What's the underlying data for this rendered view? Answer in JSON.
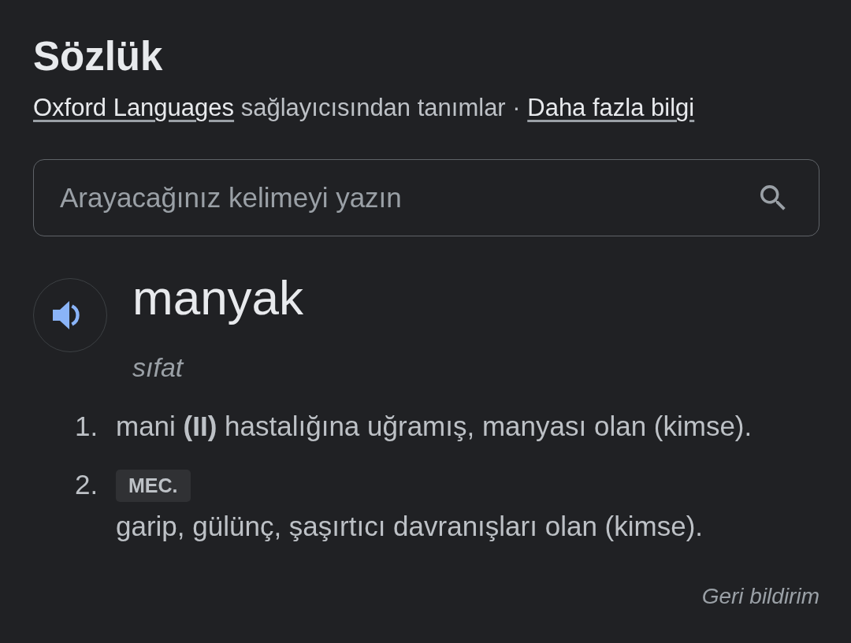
{
  "title": "Sözlük",
  "source": {
    "provider_link": "Oxford Languages",
    "text": "sağlayıcısından tanımlar ·",
    "more_link": "Daha fazla bilgi"
  },
  "search": {
    "placeholder": "Arayacağınız kelimeyi yazın"
  },
  "entry": {
    "word": "manyak",
    "part_of_speech": "sıfat",
    "senses": [
      {
        "number": "1.",
        "definition": "mani **(II)** hastalığına uğramış, manyası olan (kimse)."
      },
      {
        "number": "2.",
        "label": "MEC.",
        "definition": "garip, gülünç, şaşırtıcı davranışları olan (kimse)."
      }
    ]
  },
  "feedback": "Geri bildirim"
}
